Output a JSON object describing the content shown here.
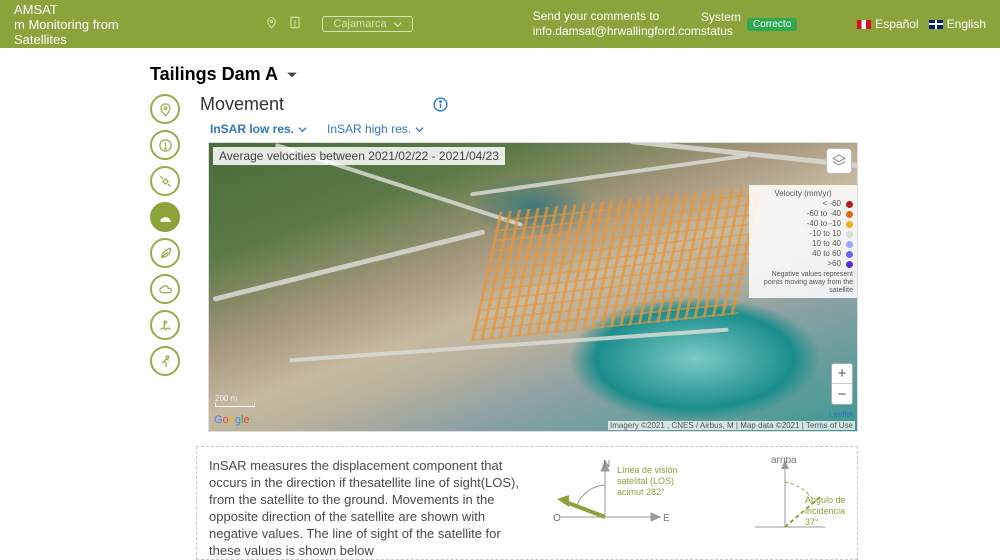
{
  "header": {
    "brand_line1": "AMSAT",
    "brand_line2": "m Monitoring from Satellites",
    "region_selected": "Cajamarca",
    "comment_line1": "Send your comments to",
    "comment_line2": "info.damsat@hrwallingford.com",
    "status_label": "System status",
    "status_value": "Correcto",
    "lang_es": "Español",
    "lang_en": "English"
  },
  "dam": {
    "title": "Tailings Dam A"
  },
  "section": {
    "title": "Movement",
    "tab_low": "InSAR low res.",
    "tab_high": "InSAR high res."
  },
  "map": {
    "caption": "Average velocities between 2021/02/22 - 2021/04/23",
    "scale_label": "200 m",
    "leaflet": "Leaflet",
    "attrib": "Imagery ©2021 , CNES / Airbus, M | Map data ©2021 | Terms of Use",
    "zoom_in": "+",
    "zoom_out": "−"
  },
  "legend": {
    "title": "Velocity (mm/yr)",
    "rows": [
      {
        "label": "< -60",
        "color": "#b02020"
      },
      {
        "label": "-60 to -40",
        "color": "#e06a1a"
      },
      {
        "label": "-40 to -10",
        "color": "#f2b01d"
      },
      {
        "label": "-10 to 10",
        "color": "#d9d9d9"
      },
      {
        "label": "10 to 40",
        "color": "#9aa6ff"
      },
      {
        "label": "40 to 60",
        "color": "#6b63ff"
      },
      {
        "label": ">60",
        "color": "#5b2bd6"
      }
    ],
    "note": "Negative values represent points moving away from the satellite"
  },
  "explain": {
    "text": "InSAR measures the displacement component that occurs in the direction if thesatellite line of sight(LOS), from the satellite to the ground. Movements in the opposite direction of the satellite are shown with negative values. The line of sight of the satellite for these values is shown below",
    "compass": {
      "n": "N",
      "o": "O",
      "e": "E",
      "los_line1": "Línea de visión",
      "los_line2": "satelital (LOS)",
      "los_line3": "acimut 282°"
    },
    "incidence": {
      "up": "arriba",
      "ang_line1": "Ángulo de",
      "ang_line2": "incidencia",
      "ang_line3": "37°"
    }
  },
  "rail_icons": [
    "pin",
    "alert",
    "satellite",
    "ground",
    "leaf",
    "cloud",
    "wave",
    "run"
  ]
}
